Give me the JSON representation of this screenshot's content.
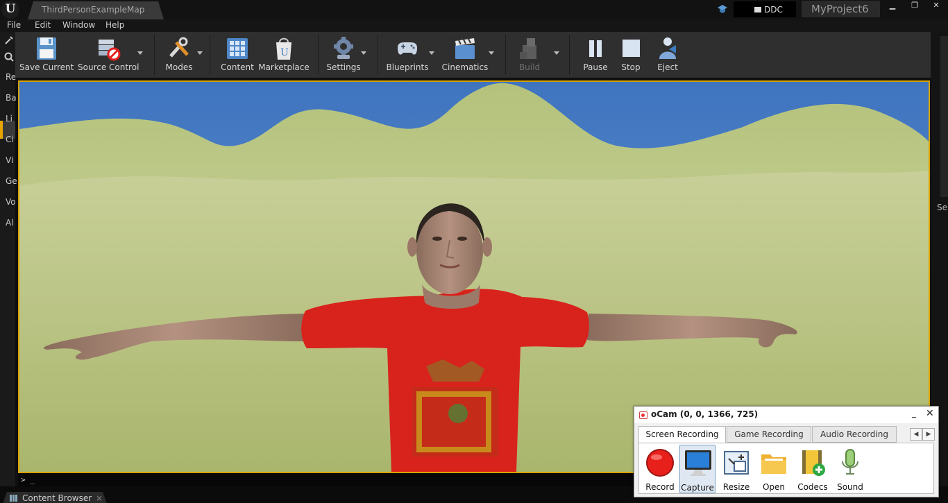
{
  "window": {
    "doc_tab": "ThirdPersonExampleMap",
    "ddc": "DDC",
    "project": "MyProject6",
    "controls": {
      "minimize": "▁",
      "maximize": "❐",
      "close": "✕"
    }
  },
  "menu": {
    "file": "File",
    "edit": "Edit",
    "window": "Window",
    "help": "Help"
  },
  "left_panel": {
    "items": [
      "Re",
      "Ba",
      "Li",
      "Ci",
      "Vi",
      "Ge",
      "Vo",
      "Al"
    ]
  },
  "right_panel": {
    "label": "Se"
  },
  "toolbar": {
    "save": "Save Current",
    "source_control": "Source Control",
    "modes": "Modes",
    "content": "Content",
    "marketplace": "Marketplace",
    "settings": "Settings",
    "blueprints": "Blueprints",
    "cinematics": "Cinematics",
    "build": "Build",
    "pause": "Pause",
    "stop": "Stop",
    "eject": "Eject"
  },
  "console": {
    "prompt": "> _"
  },
  "bottom": {
    "content_browser_tab": "Content Browser",
    "close": "×"
  },
  "ocam": {
    "title": "oCam (0, 0, 1366, 725)",
    "minimize": "_",
    "close": "✕",
    "tabs": [
      "Screen Recording",
      "Game Recording",
      "Audio Recording"
    ],
    "active_tab": "Screen Recording",
    "arrows": [
      "◀",
      "▶"
    ],
    "buttons": [
      "Record",
      "Capture",
      "Resize",
      "Open",
      "Codecs",
      "Sound"
    ],
    "active_button": "Capture"
  },
  "colors": {
    "accent": "#d9a300",
    "toolbar_bg": "#2f2f2f",
    "record_red": "#e8201c"
  }
}
